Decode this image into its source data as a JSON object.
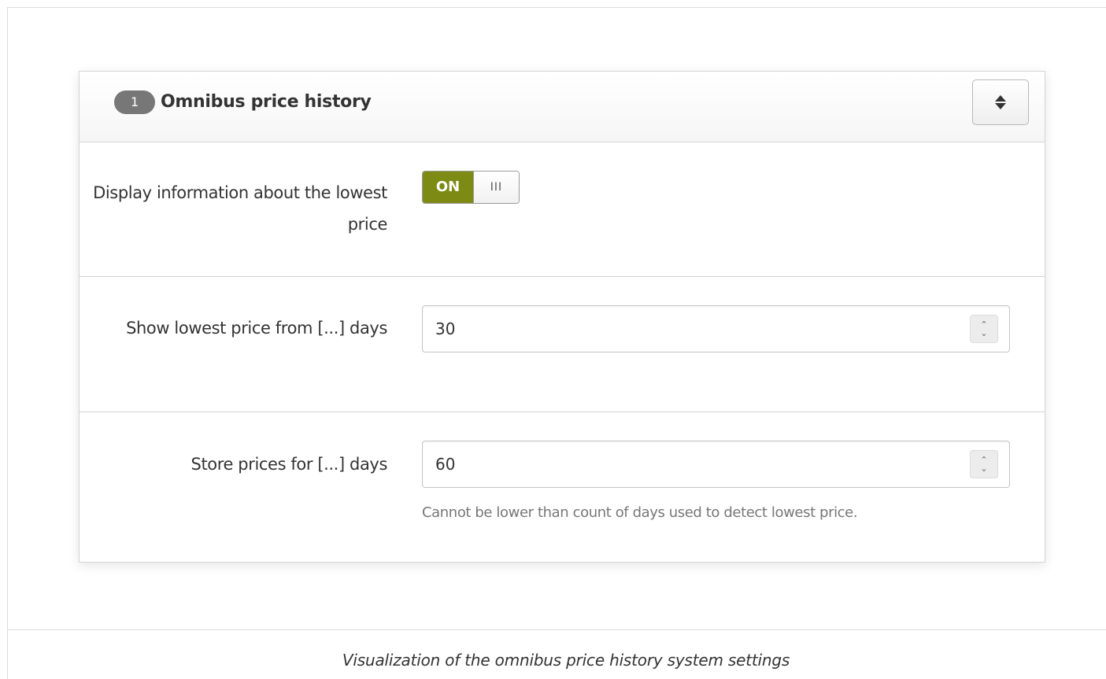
{
  "panel": {
    "step_number": "1",
    "title": "Omnibus price history",
    "collapse_icon": "sort-updown-icon"
  },
  "settings": {
    "display_info": {
      "label": "Display information about the lowest price",
      "toggle_on_label": "ON",
      "toggle_handle": "III",
      "enabled": true
    },
    "lowest_price_days": {
      "label": "Show lowest price from [...] days",
      "value": "30"
    },
    "store_days": {
      "label": "Store prices for [...] days",
      "value": "60",
      "help": "Cannot be lower than count of days used to detect lowest price."
    }
  },
  "colors": {
    "toggle_on": "#7d8a14",
    "badge": "#777777"
  },
  "caption": "Visualization of the omnibus price history system settings"
}
